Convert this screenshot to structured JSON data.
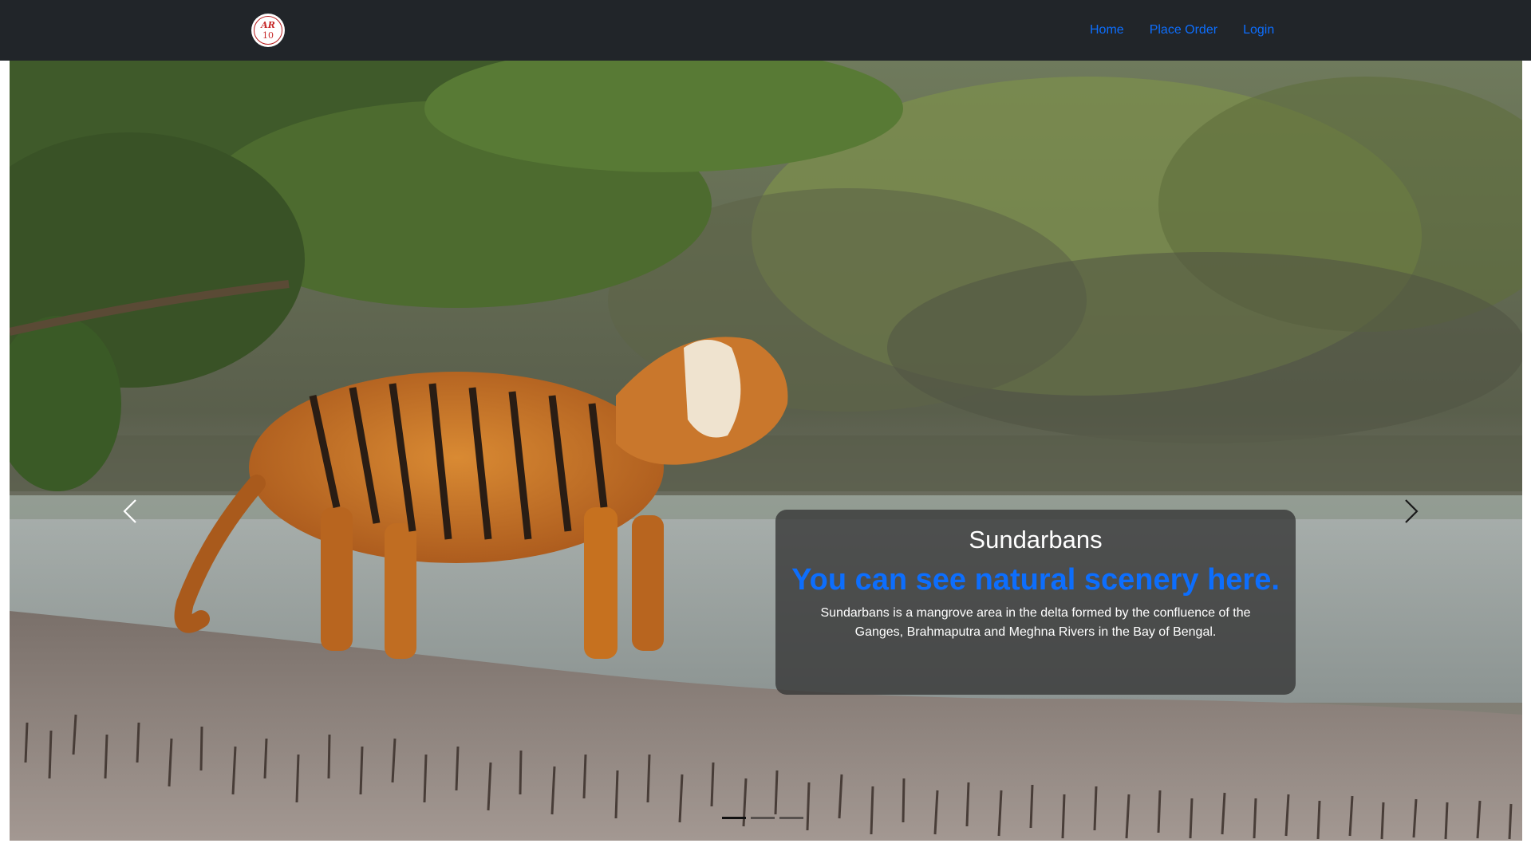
{
  "brand": {
    "logo_line1": "AR",
    "logo_line2": "10"
  },
  "nav": {
    "items": [
      {
        "label": "Home"
      },
      {
        "label": "Place Order"
      },
      {
        "label": "Login"
      }
    ]
  },
  "carousel": {
    "slide_count": 3,
    "active_index": 0,
    "caption": {
      "title": "Sundarbans",
      "subtitle": "You can see natural scenery here.",
      "description": "Sundarbans is a mangrove area in the delta formed by the confluence of the Ganges, Brahmaputra and Meghna Rivers in the Bay of Bengal."
    },
    "controls": {
      "prev_icon": "chevron-left-icon",
      "next_icon": "chevron-right-icon"
    }
  },
  "colors": {
    "navbar_bg": "#212529",
    "link": "#0d6efd",
    "caption_bg": "rgba(52,52,52,0.78)"
  }
}
